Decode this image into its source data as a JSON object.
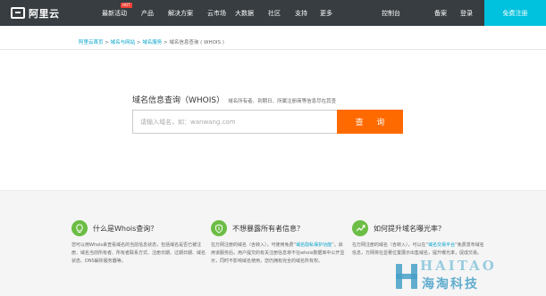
{
  "header": {
    "logo_text": "阿里云",
    "nav": [
      {
        "label": "最新活动",
        "badge": "HOT"
      },
      {
        "label": "产品"
      },
      {
        "label": "解决方案"
      },
      {
        "label": "云市场"
      },
      {
        "label": "大数据"
      },
      {
        "label": "社区"
      },
      {
        "label": "支持"
      },
      {
        "label": "更多"
      }
    ],
    "right": [
      "控制台",
      "备案",
      "登录"
    ],
    "register": "免费注册",
    "colors": {
      "bar": "#373d41",
      "accent": "#00c1de"
    }
  },
  "breadcrumb": [
    {
      "label": "阿里云首页",
      "link": true
    },
    {
      "label": "域名与网站",
      "link": true
    },
    {
      "label": "域名服务",
      "link": true
    },
    {
      "label": "域名信息查询 ( WHOIS )",
      "link": false
    }
  ],
  "search": {
    "title": "域名信息查询（WHOIS）",
    "subtitle": "域名所有者、到期日、所属注册商等信息尽在其查",
    "placeholder": "请输入域名，如：wanwang.com",
    "value": "",
    "button": "查 询",
    "button_color": "#ff6a00"
  },
  "features": [
    {
      "icon": "lightbulb-icon",
      "title": "什么是Whois查询？",
      "desc": "您可以用Whois来查看域名的当前信息状态，包括域名是否已被注册、域名当前所有者、所有者联系方式、注册日期、过期日期、域名状态、DNS解析服务器等。"
    },
    {
      "icon": "shield-icon",
      "title": "不想暴露所有者信息？",
      "desc_before": "在万网注册的域名（含转入），可使用免费“",
      "desc_link": "域名隐私保护功能",
      "desc_after": "”。启用该服务后，用户提交的有关注册信息将不在whois数据库中公开显示，同时不影响域名使用，您仍拥有完全的域名所有权。"
    },
    {
      "icon": "trend-up-icon",
      "title": "如何提升域名曝光率？",
      "desc_before": "在万网注册的域名（含转入），可以在“",
      "desc_link": "域名交易平台",
      "desc_after": "”免费发布域名信息，万网将在显著位置展示出售域名，提升曝光率，促成交易。"
    }
  ],
  "watermark": {
    "latin": "HAITAO",
    "chinese": "海淘科技"
  }
}
